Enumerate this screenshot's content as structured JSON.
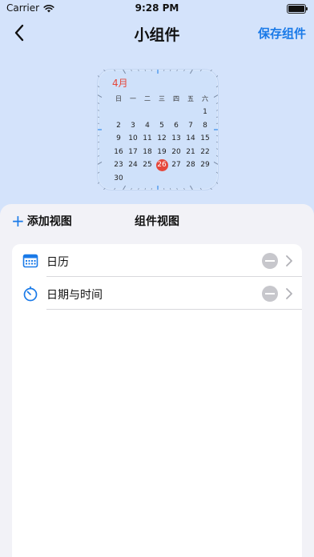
{
  "status_bar": {
    "carrier": "Carrier",
    "time": "9:28 PM"
  },
  "nav": {
    "title": "小组件",
    "save_label": "保存组件"
  },
  "widget": {
    "month": "4月",
    "weekdays": [
      "日",
      "一",
      "二",
      "三",
      "四",
      "五",
      "六"
    ],
    "first_weekday_index": 6,
    "days_in_month": 30,
    "today": 26,
    "accent_color": "#e5473b"
  },
  "sheet": {
    "add_label": "添加视图",
    "title": "组件视图",
    "items": [
      {
        "label": "日历",
        "icon": "calendar-icon"
      },
      {
        "label": "日期与时间",
        "icon": "timer-icon"
      }
    ]
  },
  "colors": {
    "accent": "#1a7ae8",
    "background": "#d4e3fb",
    "sheet": "#f2f2f7"
  }
}
